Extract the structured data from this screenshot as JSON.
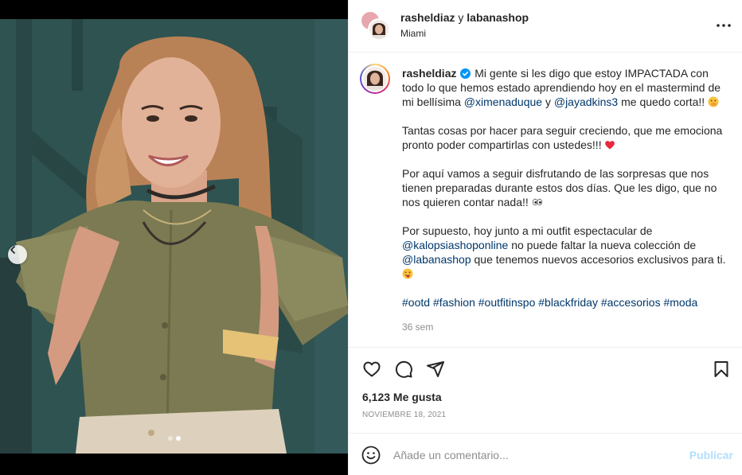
{
  "header": {
    "author": "rasheldiaz",
    "joiner": "y",
    "collaborator": "labanashop",
    "location": "Miami"
  },
  "caption": {
    "username": "rasheldiaz",
    "p1_a": " Mi gente si les digo que estoy IMPACTADA con todo lo que hemos estado aprendiendo hoy en el mastermind de mi bellísima ",
    "mention1": "@ximenaduque",
    "p1_b": " y ",
    "mention2": "@jayadkins3",
    "p1_c": " me quedo corta!! ",
    "p2": "Tantas cosas por hacer para seguir creciendo, que me emociona pronto poder compartirlas con ustedes!!! ",
    "p3": "Por aquí vamos a seguir disfrutando de las sorpresas que nos tienen preparadas durante estos dos días. Que les digo, que no nos quieren contar nada!! ",
    "p4_a": "Por supuesto, hoy junto a mi outfit espectacular de ",
    "mention3": "@kalopsiashoponline",
    "p4_b": " no puede faltar la nueva colección de ",
    "mention4": "@labanashop",
    "p4_c": " que tenemos nuevos accesorios exclusivos para ti. ",
    "hashtags": [
      "#ootd",
      "#fashion",
      "#outfitinspo",
      "#blackfriday",
      "#accesorios",
      "#moda"
    ],
    "time_ago": "36 sem"
  },
  "engagement": {
    "likes": "6,123 Me gusta",
    "date": "NOVIEMBRE 18, 2021"
  },
  "composer": {
    "placeholder": "Añade un comentario...",
    "publish_label": "Publicar"
  },
  "carousel": {
    "current": 2,
    "total": 2
  },
  "colors": {
    "link": "#00376b",
    "muted": "#8e8e8e",
    "publish_disabled": "#b2dffc",
    "verified": "#0095f6"
  },
  "icons": [
    "heart-icon",
    "comment-icon",
    "share-icon",
    "bookmark-icon",
    "more-icon",
    "emoji-icon",
    "verified-icon",
    "chevron-left-icon"
  ]
}
